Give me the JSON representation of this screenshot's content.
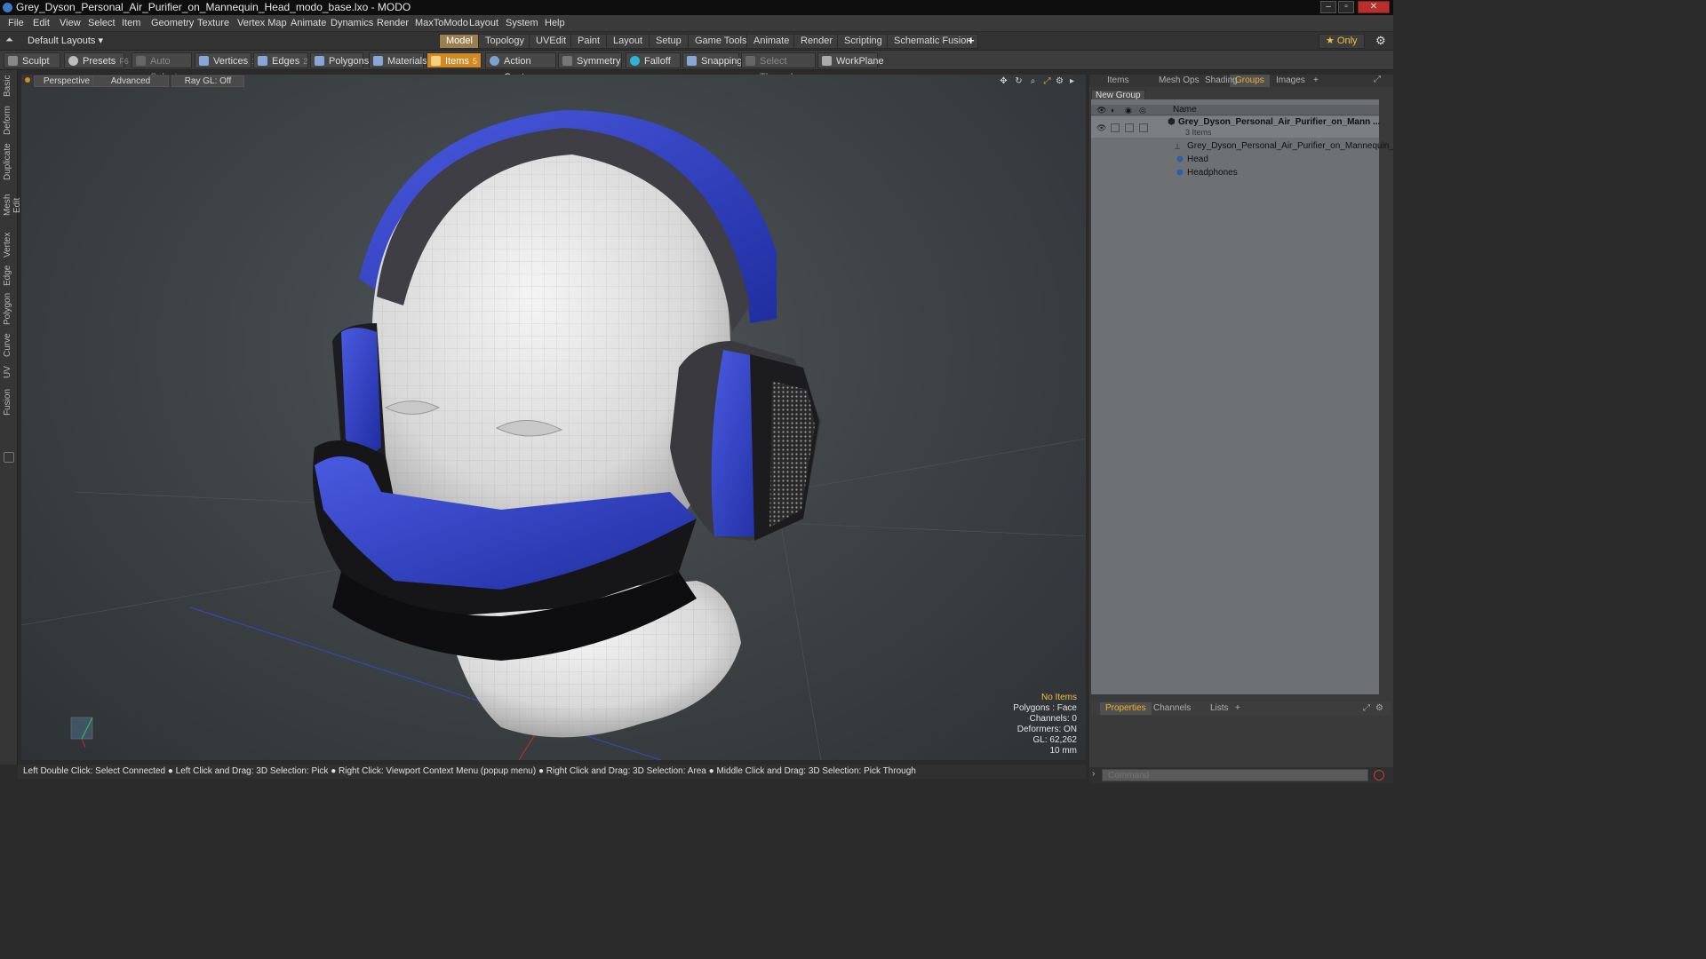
{
  "window": {
    "title": "Grey_Dyson_Personal_Air_Purifier_on_Mannequin_Head_modo_base.lxo - MODO",
    "minimize": "–",
    "maximize": "▫",
    "close": "✕"
  },
  "menu": [
    "File",
    "Edit",
    "View",
    "Select",
    "Item",
    "Geometry",
    "Texture",
    "Vertex Map",
    "Animate",
    "Dynamics",
    "Render",
    "MaxToModo",
    "Layout",
    "System",
    "Help"
  ],
  "layout_selector": "Default Layouts ▾",
  "layout_tabs": [
    "Model",
    "Topology",
    "UVEdit",
    "Paint",
    "Layout",
    "Setup",
    "Game Tools",
    "Animate",
    "Render",
    "Scripting",
    "Schematic Fusion"
  ],
  "layout_tab_add": "+",
  "only_button": "★  Only",
  "toolbar": {
    "sculpt": "Sculpt",
    "presets": "Presets",
    "presets_shortcut": "F6",
    "auto_select": "Auto Select",
    "vertices": "Vertices",
    "vertices_count": "1",
    "edges": "Edges",
    "edges_count": "2",
    "polygons": "Polygons",
    "materials": "Materials",
    "items": "Items",
    "items_count": "5",
    "action_center": "Action Center",
    "symmetry": "Symmetry",
    "falloff": "Falloff",
    "snapping": "Snapping",
    "select_through": "Select Through",
    "workplane": "WorkPlane"
  },
  "left_tabs": [
    "Basic",
    "Deform",
    "Duplicate",
    "Mesh Edit",
    "Vertex",
    "Edge",
    "Polygon",
    "Curve",
    "UV",
    "Fusion"
  ],
  "viewport": {
    "view": "Perspective",
    "shading": "Advanced",
    "raygl": "Ray GL: Off",
    "stats": {
      "selection": "No Items",
      "polygons": "Polygons : Face",
      "channels": "Channels: 0",
      "deformers": "Deformers: ON",
      "gl": "GL: 62,262",
      "scale": "10 mm"
    }
  },
  "status_bar": "Left Double Click: Select Connected ● Left Click and Drag: 3D Selection: Pick ● Right Click: Viewport Context Menu (popup menu) ● Right Click and Drag: 3D Selection: Area ● Middle Click and Drag: 3D Selection: Pick Through",
  "right_panel": {
    "tabs": [
      "Items",
      "Mesh Ops",
      "Shading",
      "Groups",
      "Images"
    ],
    "active_tab": "Groups",
    "tab_add": "+",
    "new_group": "New Group",
    "column_name": "Name",
    "tree": {
      "root": "Grey_Dyson_Personal_Air_Purifier_on_Mann ...",
      "root_count": "3 Items",
      "children": [
        "Grey_Dyson_Personal_Air_Purifier_on_Mannequin_...",
        "Head",
        "Headphones"
      ]
    },
    "bottom_tabs": [
      "Properties",
      "Channels",
      "Lists"
    ],
    "bottom_active": "Properties",
    "command_placeholder": "Command"
  },
  "colors": {
    "accent_orange": "#d08a24",
    "headphone_blue": "#2c3fc8"
  }
}
